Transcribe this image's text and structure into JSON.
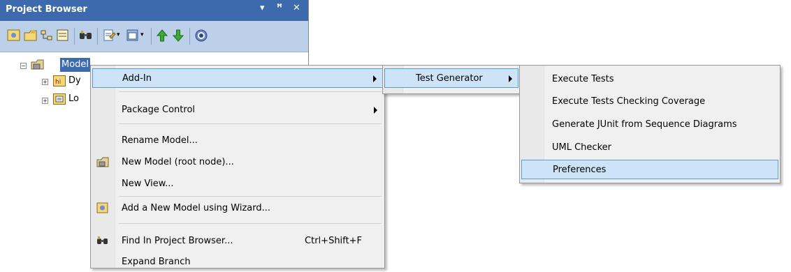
{
  "project_browser": {
    "title": "Project Browser",
    "header_buttons": {
      "dropdown": "▾",
      "pin": "ꟸ",
      "close": "✕"
    },
    "toolbar_icons": [
      "new-model-icon",
      "new-package-icon",
      "new-diagram-icon",
      "new-element-icon",
      "find-icon",
      "properties-icon",
      "view-icon",
      "move-up-icon",
      "move-down-icon",
      "help-icon"
    ],
    "tree": {
      "root": {
        "label": "Model",
        "expander": "−"
      },
      "children": [
        {
          "label": "Dy",
          "expander": "+",
          "icon": "dynamic-view-icon"
        },
        {
          "label": "Lo",
          "expander": "+",
          "icon": "logical-view-icon"
        }
      ]
    }
  },
  "context_menu": {
    "items": [
      {
        "label": "Add-In",
        "submenu": true,
        "highlighted": true
      },
      {
        "label": "Package Control",
        "submenu": true
      },
      {
        "label": "Rename Model..."
      },
      {
        "label": "New Model (root node)...",
        "icon": "new-model-icon"
      },
      {
        "label": "New View..."
      },
      {
        "label": "Add a New Model using Wizard...",
        "icon": "wizard-icon"
      },
      {
        "label": "Find In Project Browser...",
        "shortcut": "Ctrl+Shift+F",
        "icon": "find-icon"
      },
      {
        "label": "Expand Branch"
      }
    ]
  },
  "addin_submenu": {
    "items": [
      {
        "label": "Test Generator",
        "submenu": true,
        "highlighted": true
      }
    ]
  },
  "test_generator_submenu": {
    "items": [
      {
        "label": "Execute Tests"
      },
      {
        "label": "Execute Tests Checking Coverage"
      },
      {
        "label": "Generate JUnit from Sequence Diagrams"
      },
      {
        "label": "UML Checker"
      },
      {
        "label": "Preferences",
        "highlighted": true
      }
    ]
  },
  "colors": {
    "title_bar": "#3d6aad",
    "toolbar": "#bcd0ea",
    "menu_bg": "#f0f0f0",
    "highlight_bg": "#cde3f7",
    "highlight_border": "#5b9bd8"
  }
}
